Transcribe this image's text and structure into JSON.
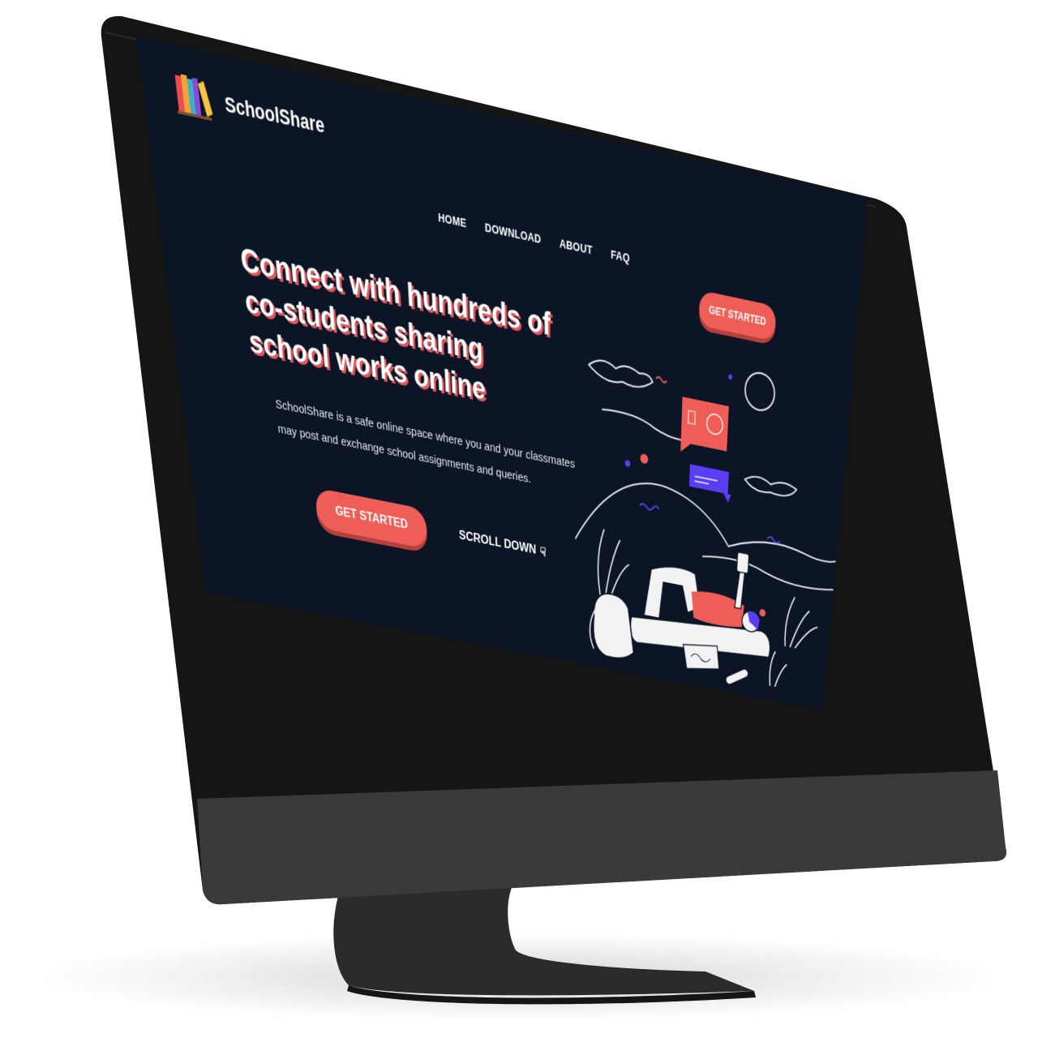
{
  "site": {
    "brand": "SchoolShare"
  },
  "nav": {
    "items": [
      "HOME",
      "DOWNLOAD",
      "ABOUT",
      "FAQ"
    ]
  },
  "header": {
    "cta_label": "GET STARTED"
  },
  "hero": {
    "headline": "Connect with hundreds of co-students sharing school works online",
    "description": "SchoolShare is a safe online space where you and your classmates may post and exchange school assignments and queries.",
    "primary_button": "GET STARTED",
    "scroll_label": "SCROLL DOWN",
    "scroll_icon": "pointer-hand-icon"
  },
  "colors": {
    "background": "#0b1526",
    "accent": "#ee5e57",
    "accent_shadow": "#b8403b",
    "purple": "#5b3df5",
    "text": "#ffffff"
  }
}
